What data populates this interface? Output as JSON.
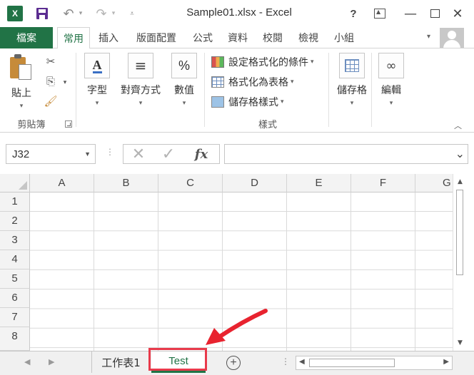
{
  "app": {
    "logo_text": "X",
    "window_title": "Sample01.xlsx - Excel"
  },
  "title_buttons": {
    "help": "?",
    "minimize": "—",
    "close": "✕"
  },
  "ribbon_tabs": {
    "file": "檔案",
    "items": [
      "常用",
      "插入",
      "版面配置",
      "公式",
      "資料",
      "校閱",
      "檢視",
      "小組"
    ],
    "active": "常用"
  },
  "ribbon": {
    "clipboard": {
      "paste_label": "貼上",
      "group_label": "剪貼簿"
    },
    "font": {
      "label": "字型",
      "icon_text": "A"
    },
    "alignment": {
      "label": "對齊方式",
      "icon_text": "≡"
    },
    "number": {
      "label": "數值",
      "icon_text": "%"
    },
    "styles": {
      "conditional_formatting": "設定格式化的條件",
      "format_as_table": "格式化為表格",
      "cell_styles": "儲存格樣式",
      "group_label": "樣式"
    },
    "cells": {
      "label": "儲存格"
    },
    "editing": {
      "label": "編輯"
    }
  },
  "formula_bar": {
    "name_box_value": "J32",
    "fx_label": "fx",
    "formula_value": ""
  },
  "grid": {
    "columns": [
      "A",
      "B",
      "C",
      "D",
      "E",
      "F",
      "G"
    ],
    "rows": [
      "1",
      "2",
      "3",
      "4",
      "5",
      "6",
      "7",
      "8"
    ]
  },
  "sheets": {
    "tabs": [
      "工作表1",
      "Test"
    ],
    "active": "Test",
    "add_label": "+"
  },
  "colors": {
    "accent": "#217346",
    "highlight": "#e83a4b"
  },
  "icons": [
    "excel-logo-icon",
    "save-icon",
    "undo-icon",
    "redo-icon",
    "customize-qat-icon",
    "help-icon",
    "ribbon-display-options-icon",
    "minimize-icon",
    "maximize-icon",
    "close-icon",
    "paste-icon",
    "cut-icon",
    "copy-icon",
    "format-painter-icon",
    "fx-icon",
    "cancel-icon",
    "enter-icon"
  ]
}
